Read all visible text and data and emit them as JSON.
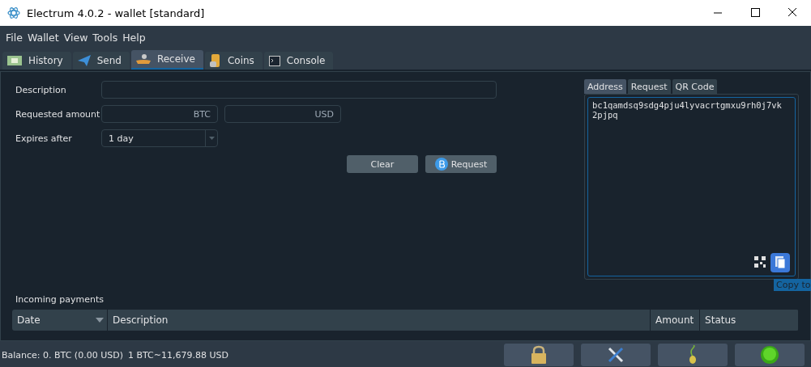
{
  "window": {
    "title": "Electrum 4.0.2  -  wallet  [standard]"
  },
  "menu": [
    "File",
    "Wallet",
    "View",
    "Tools",
    "Help"
  ],
  "tabs": [
    {
      "label": "History",
      "kind": "history",
      "selected": false
    },
    {
      "label": "Send",
      "kind": "send",
      "selected": false
    },
    {
      "label": "Receive",
      "kind": "receive",
      "selected": true
    },
    {
      "label": "Coins",
      "kind": "coins",
      "selected": false
    },
    {
      "label": "Console",
      "kind": "console",
      "selected": false
    }
  ],
  "form": {
    "description": {
      "label": "Description"
    },
    "amount": {
      "label": "Requested amount",
      "unit": "BTC",
      "fiat_unit": "USD"
    },
    "expires": {
      "label": "Expires after",
      "value": "1 day"
    },
    "buttons": [
      {
        "label": "Clear",
        "kind": "plain"
      },
      {
        "label": "Request",
        "kind": "bitcoin"
      }
    ]
  },
  "address_panel": {
    "tabs": [
      {
        "label": "Address",
        "selected": true
      },
      {
        "label": "Request",
        "selected": false
      },
      {
        "label": "QR Code",
        "selected": false
      }
    ],
    "address": "bc1qamdsq9sdg4pju4lyvacrtgmxu9rh0j7vk2pjpq",
    "tooltip": "Copy to"
  },
  "incoming": {
    "title": "Incoming payments",
    "columns": [
      "Date",
      "Description",
      "Amount",
      "Status"
    ]
  },
  "status_bar": {
    "balance": "Balance: 0. BTC (0.00 USD)",
    "rate": "1 BTC~11,679.88 USD"
  }
}
